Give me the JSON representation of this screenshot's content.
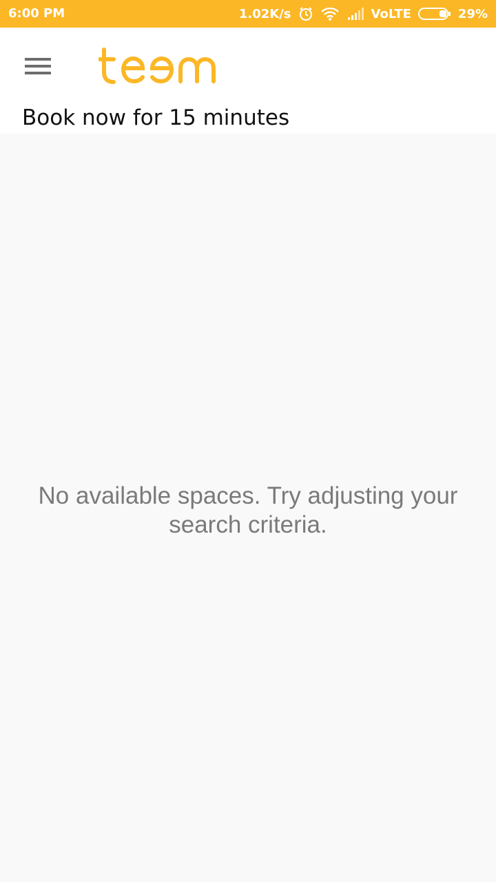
{
  "status_bar": {
    "time": "6:00 PM",
    "speed": "1.02K/s",
    "network": "VoLTE",
    "battery": "29%",
    "icons": [
      "alarm-icon",
      "wifi-icon",
      "signal-icon",
      "battery-icon"
    ]
  },
  "header": {
    "logo_text": "teem",
    "subtitle": "Book now for 15 minutes"
  },
  "main": {
    "empty_message": "No available spaces. Try adjusting your search criteria."
  },
  "colors": {
    "brand": "#fbb725",
    "background": "#f9f9f9",
    "text_muted": "#7a7a7a"
  }
}
